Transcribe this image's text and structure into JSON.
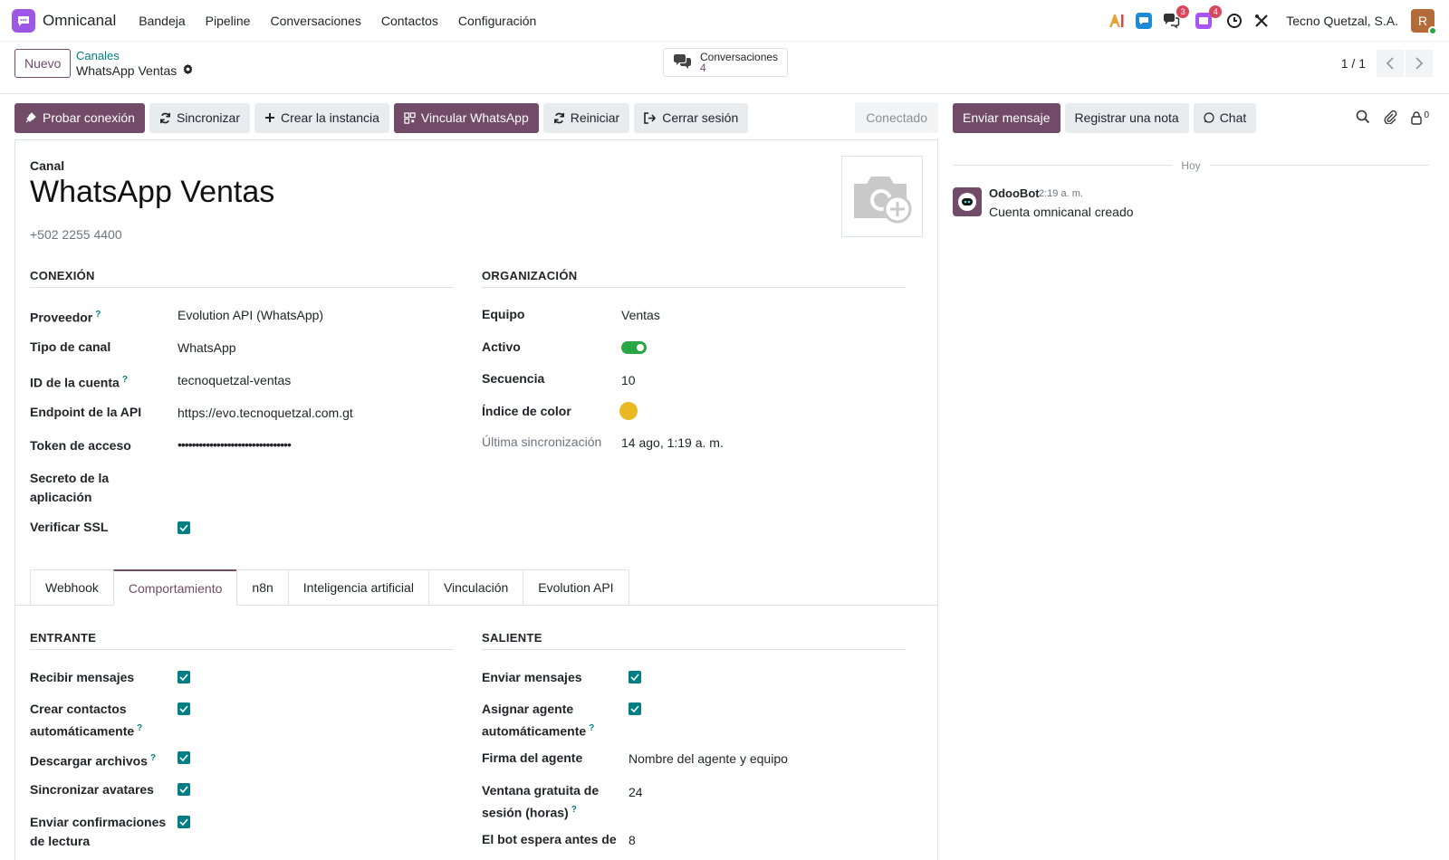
{
  "navbar": {
    "app_name": "Omnicanal",
    "menu": [
      "Bandeja",
      "Pipeline",
      "Conversaciones",
      "Contactos",
      "Configuración"
    ],
    "badges": {
      "messages": "3",
      "activities": "4"
    },
    "company": "Tecno Quetzal, S.A.",
    "user_initial": "R"
  },
  "control": {
    "new_label": "Nuevo",
    "breadcrumb_parent": "Canales",
    "breadcrumb_current": "WhatsApp Ventas",
    "stat_label": "Conversaciones",
    "stat_value": "4",
    "pager": "1 / 1"
  },
  "statusbar": {
    "buttons": [
      "Probar conexión",
      "Sincronizar",
      "Crear la instancia",
      "Vincular WhatsApp",
      "Reiniciar",
      "Cerrar sesión"
    ],
    "status": "Conectado"
  },
  "form": {
    "title_label": "Canal",
    "title": "WhatsApp Ventas",
    "phone": "+502 2255 4400",
    "connection": {
      "title": "CONEXIÓN",
      "provider_label": "Proveedor",
      "provider": "Evolution API (WhatsApp)",
      "type_label": "Tipo de canal",
      "type": "WhatsApp",
      "account_label": "ID de la cuenta",
      "account": "tecnoquetzal-ventas",
      "endpoint_label": "Endpoint de la API",
      "endpoint": "https://evo.tecnoquetzal.com.gt",
      "token_label": "Token de acceso",
      "token": "••••••••••••••••••••••••••••••••",
      "secret_label_1": "Secreto de la",
      "secret_label_2": "aplicación",
      "ssl_label": "Verificar SSL"
    },
    "organization": {
      "title": "ORGANIZACIÓN",
      "team_label": "Equipo",
      "team": "Ventas",
      "active_label": "Activo",
      "sequence_label": "Secuencia",
      "sequence": "10",
      "color_label": "Índice de color",
      "color": "#e8b923",
      "last_sync_label": "Última sincronización",
      "last_sync": "14 ago, 1:19 a. m."
    },
    "tabs": [
      "Webhook",
      "Comportamiento",
      "n8n",
      "Inteligencia artificial",
      "Vinculación",
      "Evolution API"
    ],
    "incoming": {
      "title": "ENTRANTE",
      "receive": "Recibir mensajes",
      "create_1": "Crear contactos",
      "create_2": "automáticamente",
      "download": "Descargar archivos",
      "sync_avatars": "Sincronizar avatares",
      "read_1": "Enviar confirmaciones",
      "read_2": "de lectura"
    },
    "outgoing": {
      "title": "SALIENTE",
      "send": "Enviar mensajes",
      "assign_1": "Asignar agente",
      "assign_2": "automáticamente",
      "signature_label": "Firma del agente",
      "signature": "Nombre del agente y equipo",
      "window_1": "Ventana gratuita de",
      "window_2": "sesión (horas)",
      "window": "24",
      "bot_wait_1": "El bot espera antes de",
      "bot_wait": "8"
    }
  },
  "chatter": {
    "send_message": "Enviar mensaje",
    "log_note": "Registrar una nota",
    "chat": "Chat",
    "followers": "0",
    "date_separator": "Hoy",
    "message": {
      "author": "OdooBot",
      "time": "2:19 a. m.",
      "body": "Cuenta omnicanal creado"
    }
  },
  "colors": {
    "primary": "#714b67",
    "accent": "#017e84",
    "success": "#28a745",
    "badge": "#d9475c"
  }
}
